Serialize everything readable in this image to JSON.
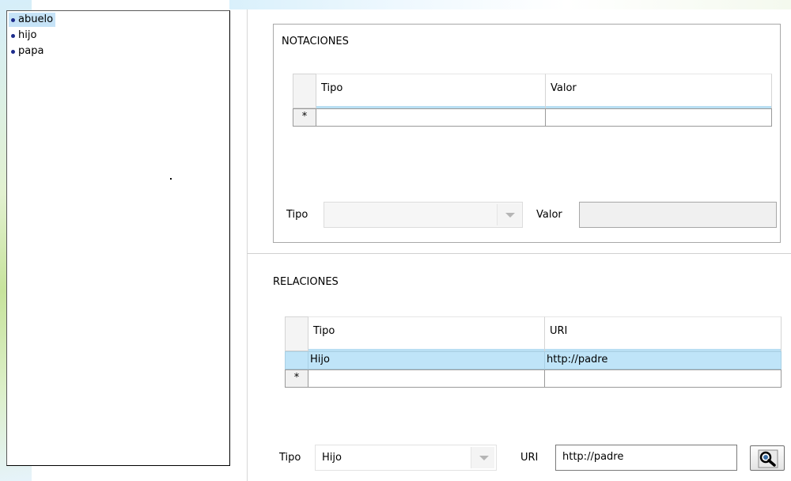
{
  "tree": {
    "items": [
      {
        "label": "abuelo",
        "selected": true
      },
      {
        "label": "hijo",
        "selected": false
      },
      {
        "label": "papa",
        "selected": false
      }
    ]
  },
  "notaciones": {
    "title": "NOTACIONES",
    "columns": [
      "Tipo",
      "Valor"
    ],
    "new_row_marker": "*",
    "rows": [],
    "form": {
      "tipo_label": "Tipo",
      "tipo_value": "",
      "valor_label": "Valor",
      "valor_value": ""
    }
  },
  "relaciones": {
    "title": "RELACIONES",
    "columns": [
      "Tipo",
      "URI"
    ],
    "new_row_marker": "*",
    "rows": [
      {
        "tipo": "Hijo",
        "uri": "http://padre"
      }
    ],
    "form": {
      "tipo_label": "Tipo",
      "tipo_value": "Hijo",
      "uri_label": "URI",
      "uri_value": "http://padre"
    }
  },
  "icons": {
    "browse": "search-binoculars-icon",
    "tree_bullet": "bullet-icon",
    "dropdown": "chevron-down-icon"
  },
  "colors": {
    "selection": "#c6e3f7",
    "row_selection": "#bfe4f8",
    "bullet": "#1d2c8c"
  }
}
